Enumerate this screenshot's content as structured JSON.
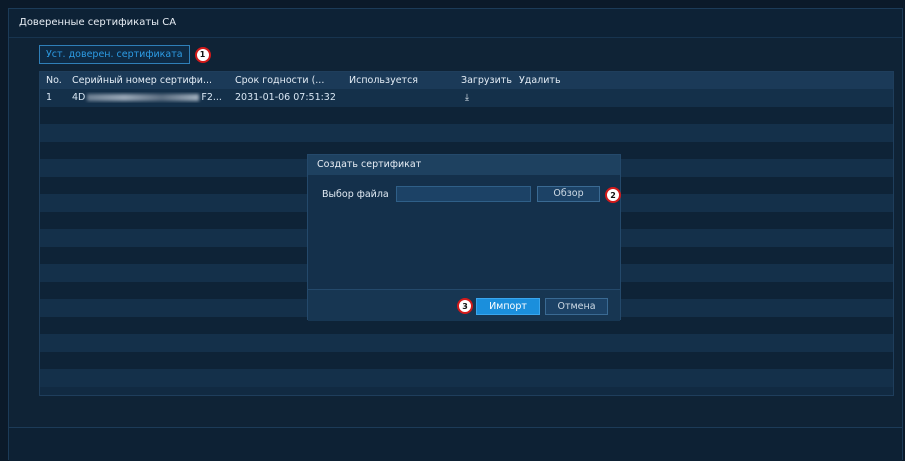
{
  "window": {
    "title": "Доверенные сертификаты CA"
  },
  "toolbar": {
    "install_label": "Уст. доверен. сертификата"
  },
  "callouts": {
    "one": "1",
    "two": "2",
    "three": "3"
  },
  "table": {
    "columns": [
      "No.",
      "Серийный номер сертифи...",
      "Срок годности (...",
      "Используется",
      "Загрузить",
      "Удалить"
    ],
    "rows": [
      {
        "no": "1",
        "serial_prefix": "4D",
        "serial_suffix": "F2...",
        "expiry": "2031-01-06 07:51:32",
        "used": "",
        "download_icon": "download-icon"
      }
    ]
  },
  "dialog": {
    "title": "Создать сертификат",
    "file_label": "Выбор файла",
    "file_value": "",
    "browse_label": "Обзор",
    "import_label": "Импорт",
    "cancel_label": "Отмена"
  },
  "colors": {
    "accent": "#1b8fdc",
    "callout_border": "#d21a1a",
    "background": "#0b1a2a"
  }
}
